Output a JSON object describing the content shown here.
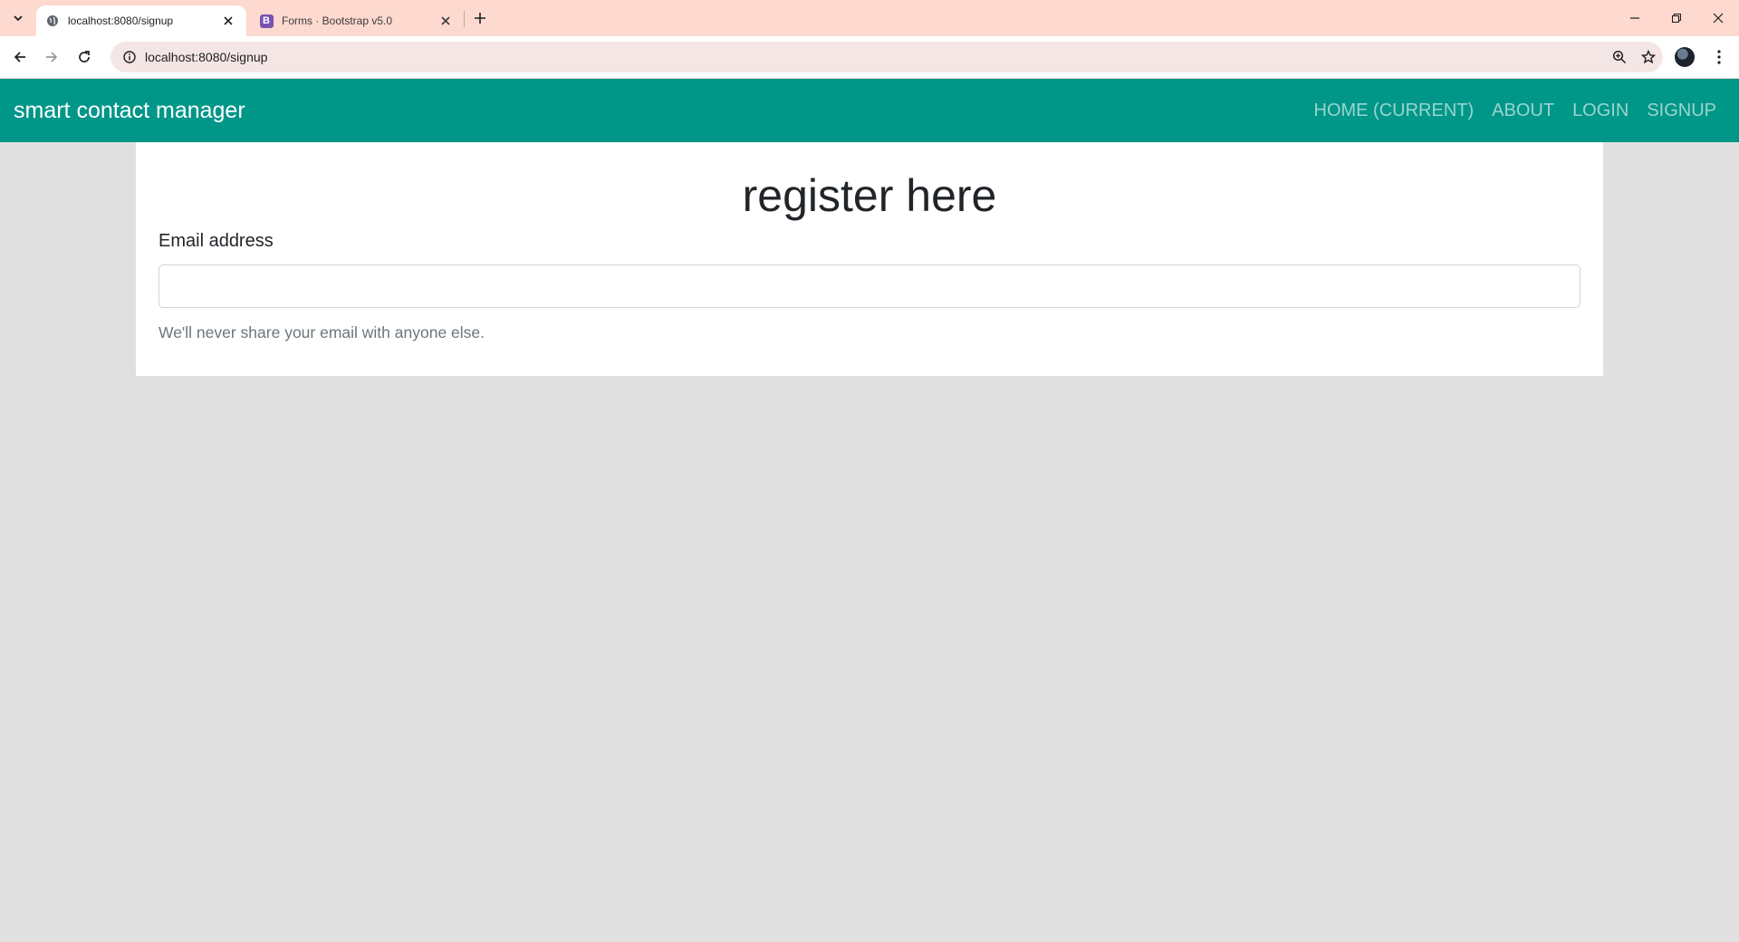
{
  "browser": {
    "tabs": [
      {
        "title": "localhost:8080/signup",
        "active": true,
        "icon": "globe-icon"
      },
      {
        "title": "Forms · Bootstrap v5.0",
        "active": false,
        "icon": "bootstrap-icon",
        "icon_letter": "B"
      }
    ],
    "url": "localhost:8080/signup",
    "accent_color": "#fdd9cf"
  },
  "app": {
    "brand": "smart contact manager",
    "nav_color": "#009688",
    "nav": [
      {
        "label": "Home (current)"
      },
      {
        "label": "About"
      },
      {
        "label": "Login"
      },
      {
        "label": "Signup"
      }
    ]
  },
  "form": {
    "heading": "register here",
    "email_label": "Email address",
    "email_value": "",
    "email_help": "We'll never share your email with anyone else."
  }
}
